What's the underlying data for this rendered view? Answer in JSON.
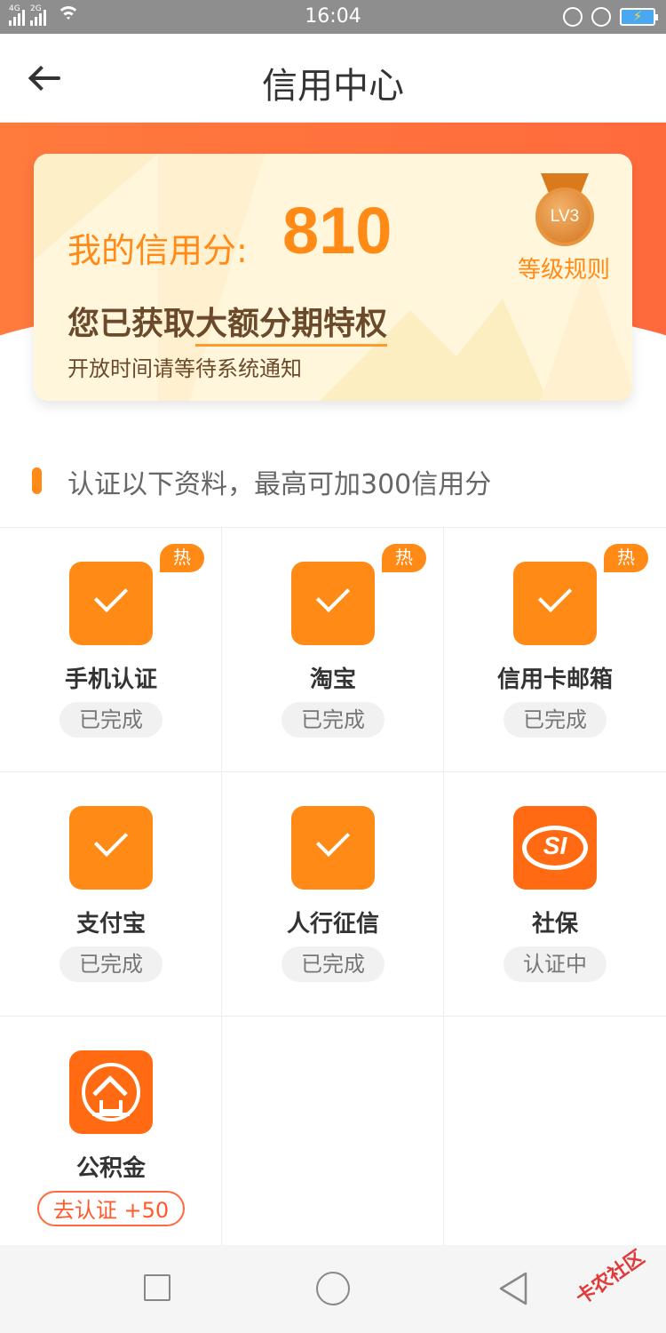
{
  "status_bar": {
    "time": "16:04",
    "network_1": "4G",
    "network_2": "2G"
  },
  "header": {
    "title": "信用中心"
  },
  "credit": {
    "score_label": "我的信用分:",
    "score": "810",
    "level_badge": "LV3",
    "level_rules_label": "等级规则",
    "privilege_prefix": "您已获取",
    "privilege_emphasis": "大额分期特权",
    "notice": "开放时间请等待系统通知"
  },
  "section": {
    "title": "认证以下资料，最高可加300信用分"
  },
  "auth_items": [
    {
      "name": "手机认证",
      "status": "已完成",
      "hot": "热",
      "icon": "check-icon"
    },
    {
      "name": "淘宝",
      "status": "已完成",
      "hot": "热",
      "icon": "check-icon"
    },
    {
      "name": "信用卡邮箱",
      "status": "已完成",
      "hot": "热",
      "icon": "check-icon"
    },
    {
      "name": "支付宝",
      "status": "已完成",
      "icon": "check-icon"
    },
    {
      "name": "人行征信",
      "status": "已完成",
      "icon": "check-icon"
    },
    {
      "name": "社保",
      "status": "认证中",
      "icon": "social-security-icon",
      "logo_text": "SI"
    },
    {
      "name": "公积金",
      "status": "去认证 +50",
      "icon": "housing-fund-icon"
    }
  ],
  "watermark": "卡农社区",
  "colors": {
    "accent": "#ff8a16",
    "banner": "#ff6a3d",
    "card": "#fff6dc"
  }
}
